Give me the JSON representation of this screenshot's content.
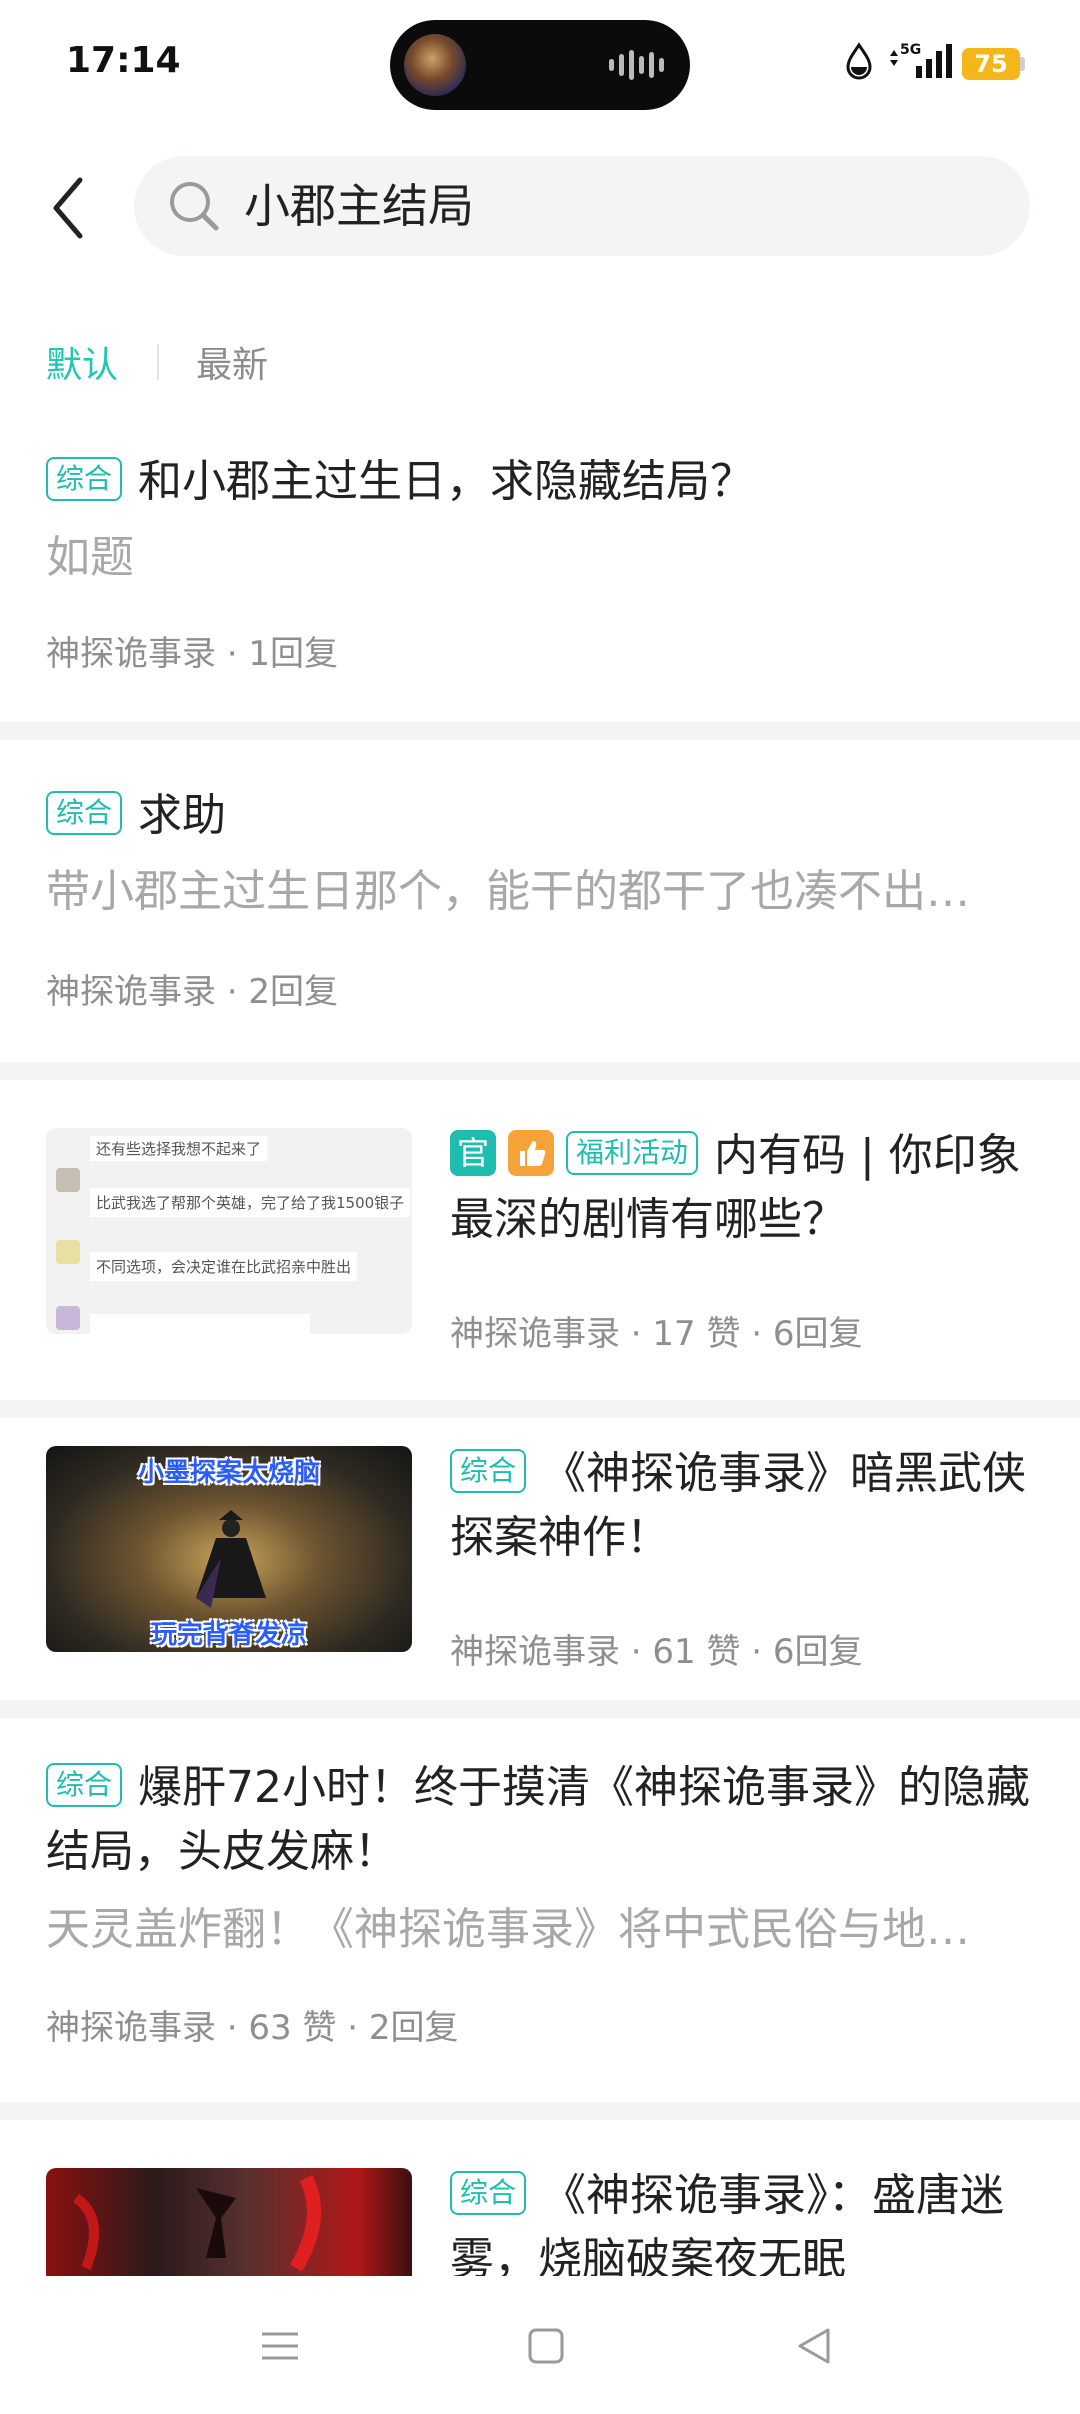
{
  "status_bar": {
    "time": "17:14",
    "network": "5G",
    "battery": "75",
    "battery_color": "#f3b71c"
  },
  "search": {
    "query": "小郡主结局",
    "icon": "search-icon"
  },
  "sort_tabs": {
    "default_label": "默认",
    "latest_label": "最新",
    "active": "默认",
    "accent": "#1fc7b5"
  },
  "posts": [
    {
      "tag": "综合",
      "title": "和小郡主过生日，求隐藏结局？",
      "excerpt": "如题",
      "meta": "神探诡事录 · 1回复"
    },
    {
      "tag": "综合",
      "title": "求助",
      "excerpt": "带小郡主过生日那个，能干的都干了也凑不出…",
      "meta": "神探诡事录 · 2回复"
    },
    {
      "badge_official": "官",
      "badge_icon": "thumbs-up-icon",
      "tag": "福利活动",
      "title": "内有码 | 你印象最深的剧情有哪些？",
      "meta": "神探诡事录 · 17 赞 · 6回复",
      "thumb_lines": [
        "还有些选择我想不起来了",
        "比武我选了帮那个英雄，完了给了我1500银子",
        "不同选项，会决定谁在比武招亲中胜出"
      ]
    },
    {
      "tag": "综合",
      "title": "《神探诡事录》暗黑武侠探案神作！",
      "meta": "神探诡事录 · 61 赞 · 6回复",
      "thumb_top": "小墨探案太烧脑",
      "thumb_bottom": "玩完背脊发凉"
    },
    {
      "tag": "综合",
      "title": "爆肝72小时！终于摸清《神探诡事录》的隐藏结局，头皮发麻！",
      "excerpt": "天灵盖炸翻！《神探诡事录》将中式民俗与地…",
      "meta": "神探诡事录 · 63 赞 · 2回复"
    },
    {
      "tag": "综合",
      "title": "《神探诡事录》：盛唐迷雾，烧脑破案夜无眠"
    }
  ],
  "nav_bar": {
    "menu_icon": "menu-icon",
    "home_icon": "home-square-icon",
    "back_icon": "back-triangle-icon"
  }
}
